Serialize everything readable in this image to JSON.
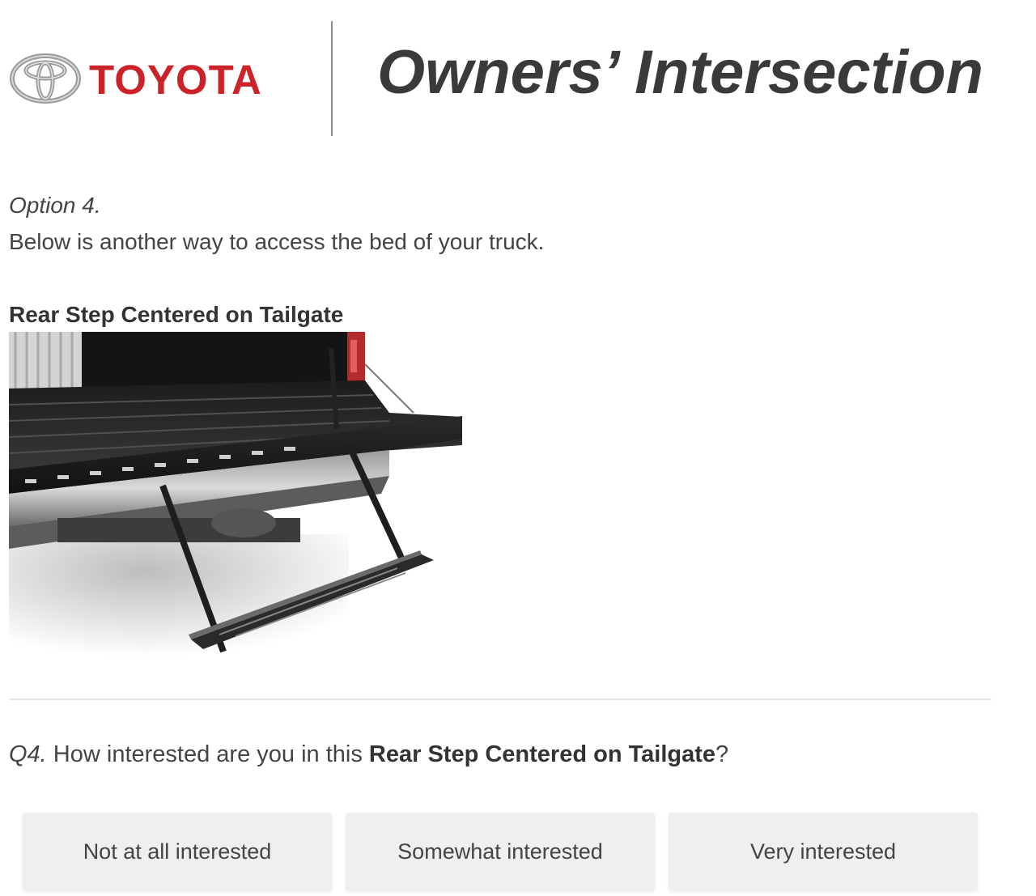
{
  "header": {
    "brand_word": "TOYOTA",
    "brand_icon": "toyota-emblem",
    "title": "Owners’ Intersection",
    "brand_color": "#cc2229"
  },
  "option": {
    "label": "Option 4.",
    "intro": "Below is another way to access the bed of your truck."
  },
  "feature": {
    "title": "Rear Step Centered on Tailgate",
    "image_icon": "rear-step-tailgate-photo"
  },
  "question": {
    "number": "Q4.",
    "text_before": " How interested are you in this ",
    "subject": "Rear Step Centered on Tailgate",
    "text_after": "?"
  },
  "answers": [
    {
      "label": "Not at all interested"
    },
    {
      "label": "Somewhat interested"
    },
    {
      "label": "Very interested"
    }
  ]
}
